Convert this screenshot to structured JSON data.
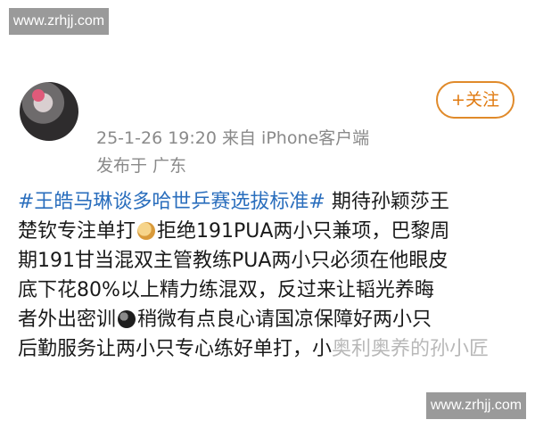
{
  "watermark": {
    "top": "www.zrhjj.com",
    "bottom": "www.zrhjj.com"
  },
  "post": {
    "timestamp": "25-1-26 19:20",
    "source": "来自 iPhone客户端",
    "location": "发布于 广东",
    "follow_label": "+关注",
    "lines": [
      {
        "hashtag": "#王皓马琳谈多哈世乒赛选拔标准#",
        "text": " 期待孙颖莎王"
      },
      {
        "text_a": "楚钦专注单打",
        "emoji": "fist-emoji",
        "text_b": "拒绝191PUA两小只兼项，巴黎周"
      },
      {
        "text": "期191甘当混双主管教练PUA两小只必须在他眼皮"
      },
      {
        "text": "底下花80%以上精力练混双，反过来让韬光养晦"
      },
      {
        "text_a": "者外出密训",
        "emoji": "bomb-emoji",
        "text_b": "稍微有点良心请国凉保障好两小只"
      },
      {
        "text": "后勤服务让两小只专心练好单打，小",
        "overlay": "奥利奥养的孙小匠"
      }
    ]
  },
  "colors": {
    "hashtag": "#2a6ebd",
    "follow": "#e07a10",
    "meta": "#8a8a8a",
    "watermark_bg": "#9a9a9a"
  }
}
